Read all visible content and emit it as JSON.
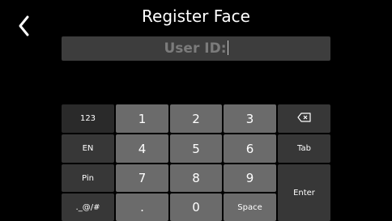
{
  "header": {
    "title": "Register Face",
    "back_icon": "chevron-left-icon"
  },
  "input": {
    "label": "User ID:"
  },
  "keyboard": {
    "mode_123": "123",
    "mode_en": "EN",
    "pin": "Pin",
    "symbols": "._@/#",
    "k1": "1",
    "k2": "2",
    "k3": "3",
    "k4": "4",
    "k5": "5",
    "k6": "6",
    "k7": "7",
    "k8": "8",
    "k9": "9",
    "dot": ".",
    "k0": "0",
    "space": "Space",
    "backspace_icon": "backspace-icon",
    "tab": "Tab",
    "enter": "Enter"
  },
  "colors": {
    "background": "#000000",
    "input_bg": "#3d3d3d",
    "input_text": "#7b7b7b",
    "func_key": "#373737",
    "num_key": "#6b6b6b"
  }
}
